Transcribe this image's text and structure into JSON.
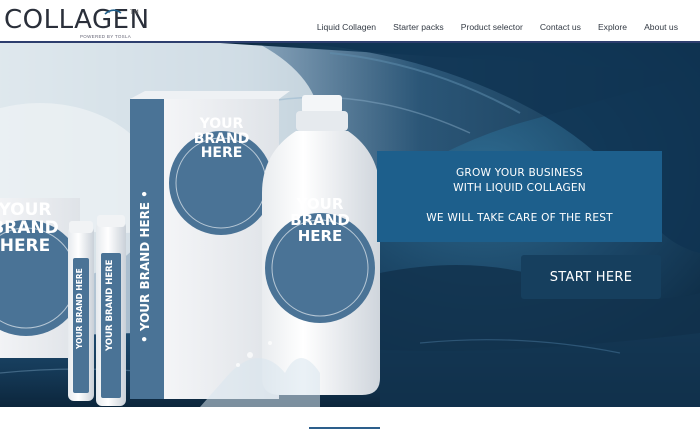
{
  "logo": {
    "word": "COLLAGEN",
    "tm": "TM",
    "sub": "POWERED BY TOSLA"
  },
  "nav": {
    "items": [
      "Liquid Collagen",
      "Starter packs",
      "Product selector",
      "Contact us",
      "Explore",
      "About us"
    ]
  },
  "hero": {
    "panel_line1": "GROW YOUR BUSINESS",
    "panel_line2": "WITH LIQUID COLLAGEN",
    "panel_line3": "WE WILL TAKE CARE OF THE REST",
    "cta_label": "START HERE",
    "brand_box": "YOUR BRAND HERE",
    "brand_bottle": "YOUR BRAND HERE",
    "brand_left": "YOUR BRAND HERE",
    "vial_text": "YOUR BRAND HERE",
    "box_side_text": "• YOUR BRAND HERE •"
  },
  "colors": {
    "panel": "#1d5f8c",
    "cta": "#163f5e",
    "brand_blue": "#4a7396",
    "header_rule": "#2d3e6e"
  }
}
